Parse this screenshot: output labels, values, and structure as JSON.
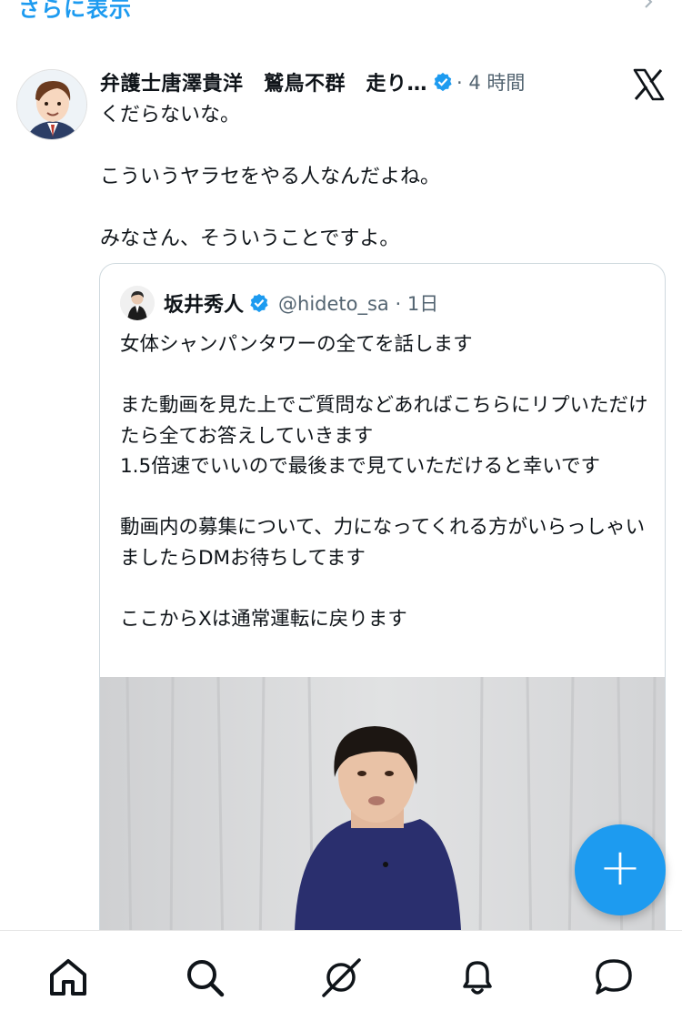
{
  "top": {
    "show_more_label": "さらに表示"
  },
  "post": {
    "author_name": "弁護士唐澤貴洋　鷲鳥不群　走り…",
    "meta": "· 4 時間",
    "body": "くだらないな。\n\nこういうヤラセをやる人なんだよね。\n\nみなさん、そういうことですよ。"
  },
  "quote": {
    "name": "坂井秀人",
    "handle_time": "@hideto_sa · 1日",
    "body": "女体シャンパンタワーの全てを話します\n\nまた動画を見た上でご質問などあればこちらにリプいただけたら全てお答えしていきます\n1.5倍速でいいので最後まで見ていただけると幸いです\n\n動画内の募集について、力になってくれる方がいらっしゃいましたらDMお待ちしてます\n\nここからXは通常運転に戻ります"
  },
  "fab": {
    "label": "+"
  },
  "nav": {
    "items": [
      {
        "icon": "home-icon"
      },
      {
        "icon": "search-icon"
      },
      {
        "icon": "grok-icon"
      },
      {
        "icon": "bell-icon"
      },
      {
        "icon": "chat-icon"
      }
    ]
  },
  "colors": {
    "accent": "#1d9bf0",
    "text": "#0f1419",
    "muted": "#536471",
    "border": "#cfd9de"
  }
}
